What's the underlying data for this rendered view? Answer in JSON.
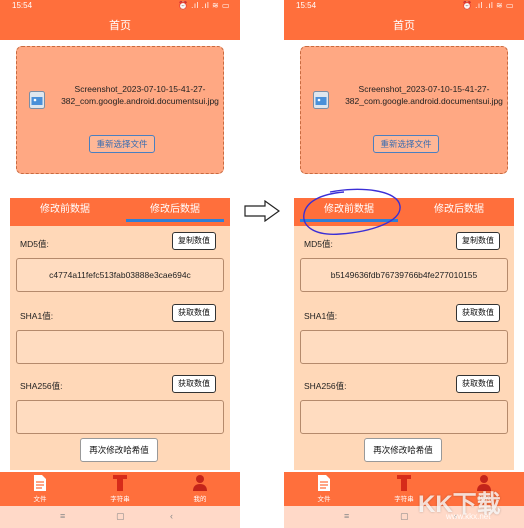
{
  "left_phone": {
    "status": {
      "time": "15:54",
      "icons": "⏰       .ıl .ıl ≋ ▭"
    },
    "title": "首页",
    "file_name": "Screenshot_2023-07-10-15-41-27-382_com.google.android.documentsui.jpg",
    "reselect_label": "重新选择文件",
    "tabs": [
      "修改前数据",
      "修改后数据"
    ],
    "active_tab": 1,
    "md5_label": "MD5值:",
    "md5_button": "复制数值",
    "md5_value": "c4774a11fefc513fab03888e3cae694c",
    "sha1_label": "SHA1值:",
    "sha1_button": "获取数值",
    "sha1_value": "",
    "sha256_label": "SHA256值:",
    "sha256_button": "获取数值",
    "sha256_value": "",
    "again_label": "再次修改哈希值",
    "nav": [
      "文件",
      "字符串",
      "我的"
    ]
  },
  "right_phone": {
    "status": {
      "time": "15:54",
      "icons": "⏰       .ıl .ıl ≋ ▭"
    },
    "title": "首页",
    "file_name": "Screenshot_2023-07-10-15-41-27-382_com.google.android.documentsui.jpg",
    "reselect_label": "重新选择文件",
    "tabs": [
      "修改前数据",
      "修改后数据"
    ],
    "active_tab": 0,
    "md5_label": "MD5值:",
    "md5_button": "复制数值",
    "md5_value": "b5149636fdb76739766b4fe277010155",
    "sha1_label": "SHA1值:",
    "sha1_button": "获取数值",
    "sha1_value": "",
    "sha256_label": "SHA256值:",
    "sha256_button": "获取数值",
    "sha256_value": "",
    "again_label": "再次修改哈希值",
    "nav": [
      "文件",
      "字符串",
      "我的"
    ]
  },
  "system_nav": {
    "menu": "≡",
    "home": "▢",
    "back": "‹"
  },
  "watermark": {
    "big": "KK下载",
    "small": "www.kkx.net"
  },
  "colors": {
    "accent": "#ff6f3c",
    "panel": "#ffd8b8",
    "card": "#ffa883",
    "tab_underline": "#2f7fd6",
    "annotation": "#3b2fd6"
  }
}
